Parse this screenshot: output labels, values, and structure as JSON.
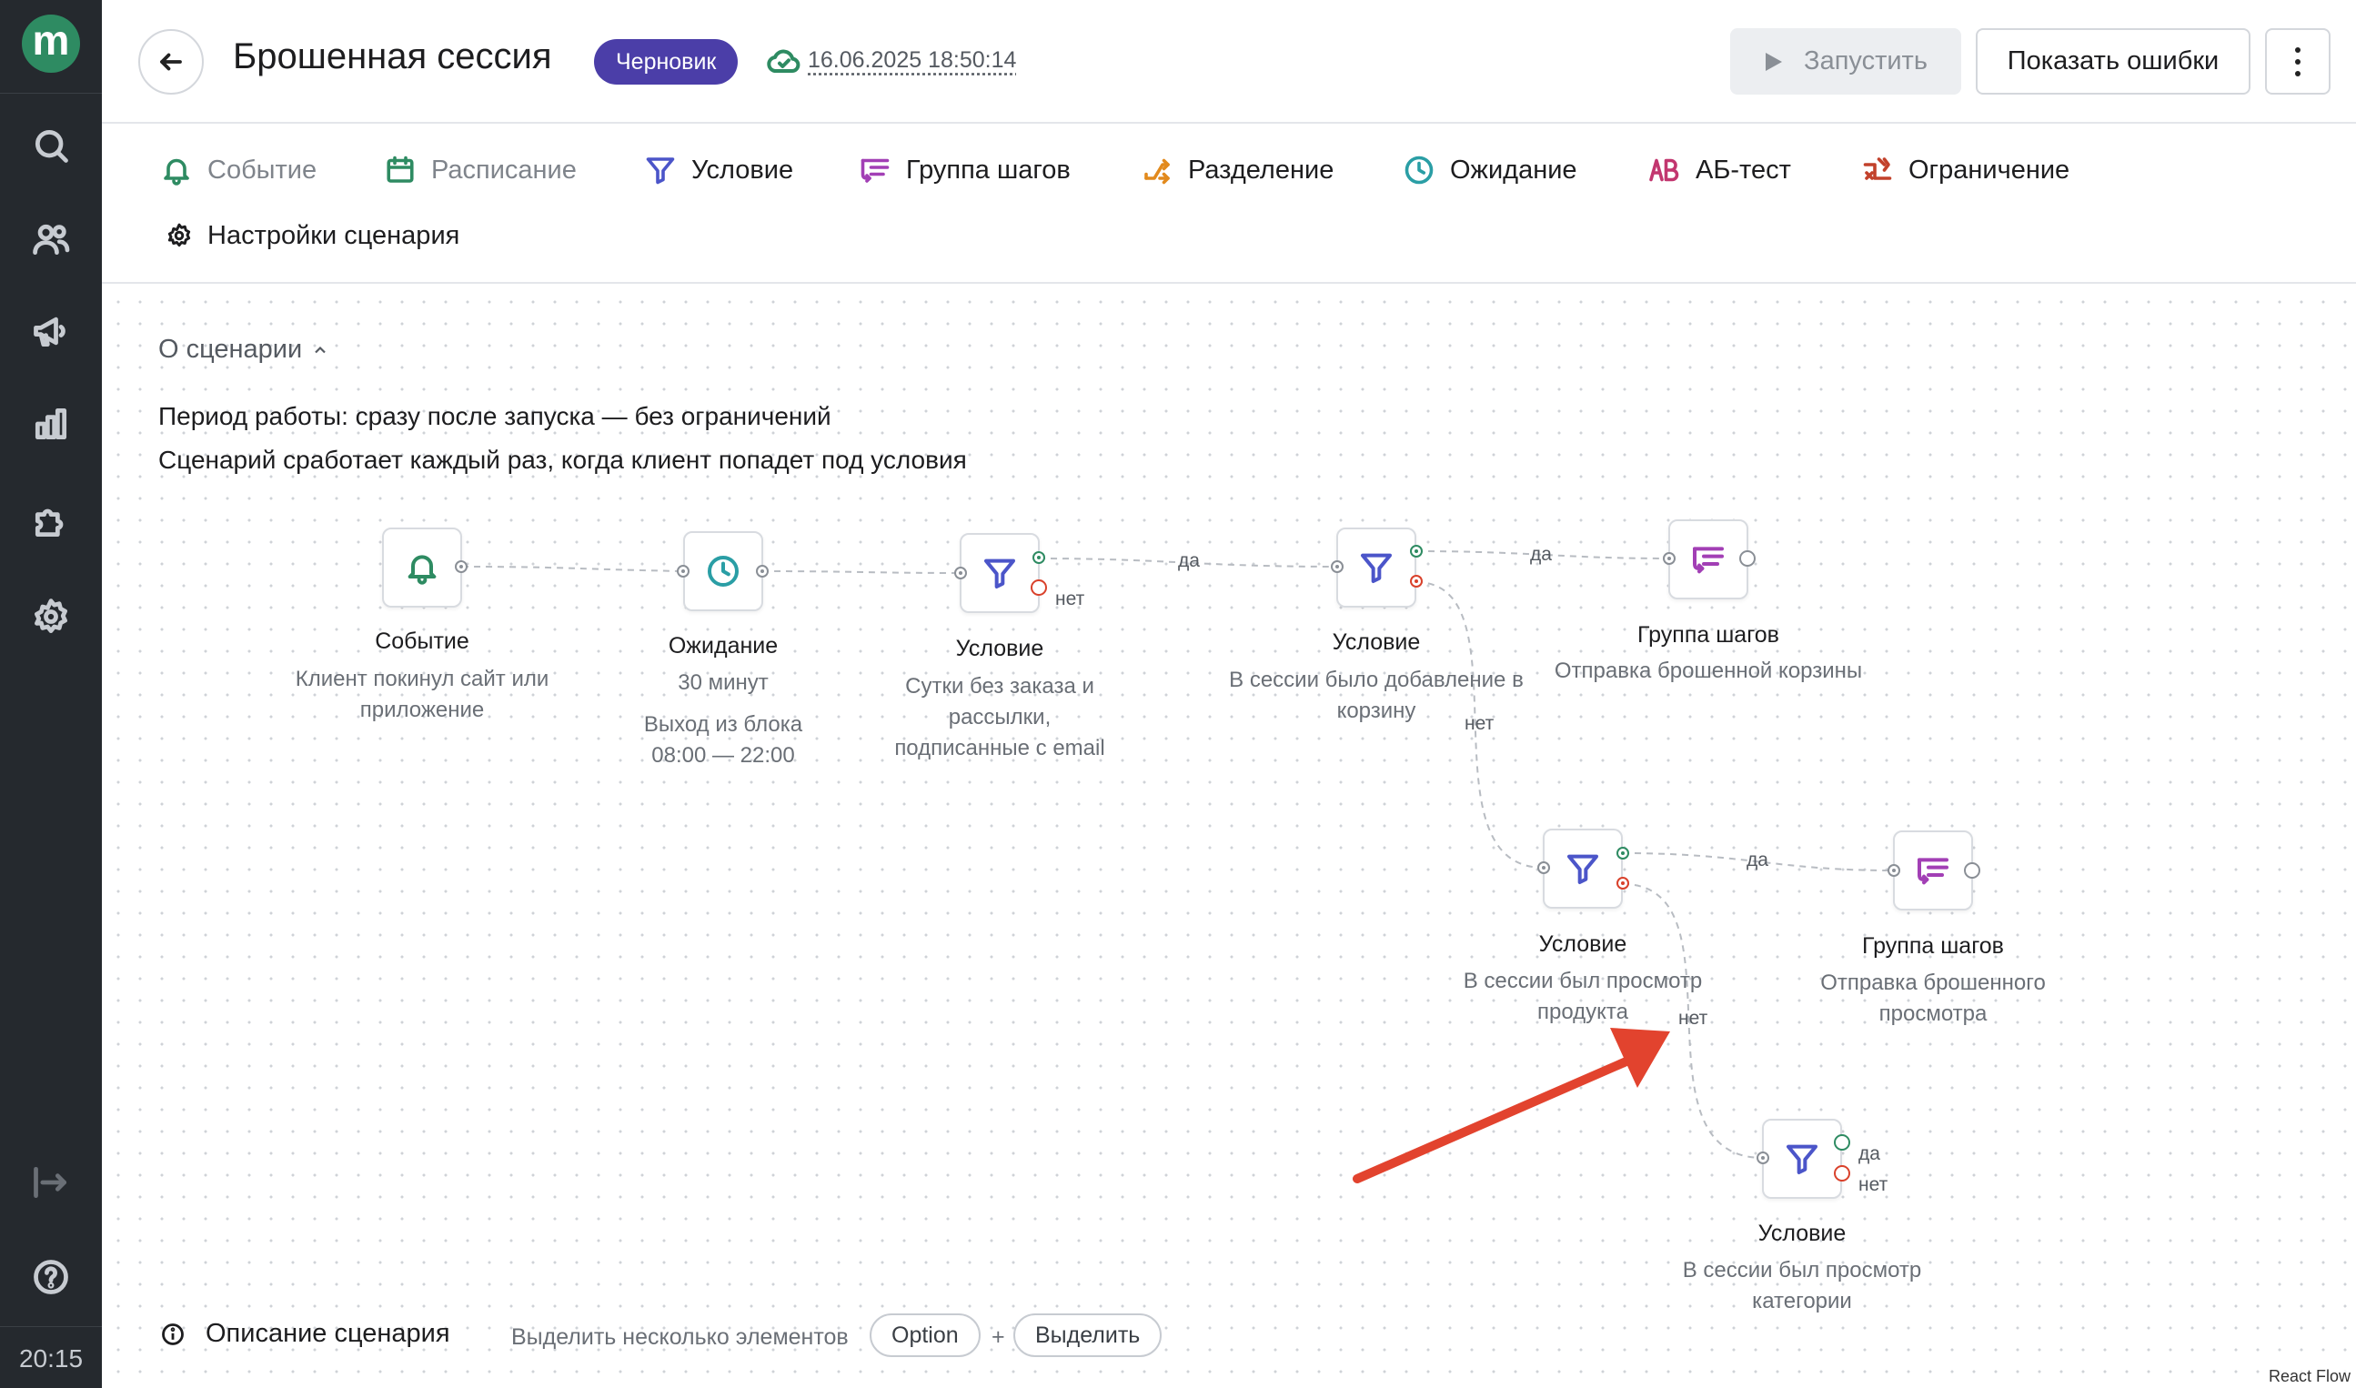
{
  "sidebar": {
    "logo": "m",
    "items": [
      {
        "name": "search-icon"
      },
      {
        "name": "users-icon"
      },
      {
        "name": "megaphone-icon"
      },
      {
        "name": "analytics-icon"
      },
      {
        "name": "puzzle-icon"
      },
      {
        "name": "gear-icon"
      }
    ],
    "collapse_icon": "collapse-icon",
    "help_icon": "help-icon",
    "time": "20:15"
  },
  "header": {
    "title": "Брошенная сессия",
    "status": "Черновик",
    "saved_at": "16.06.2025 18:50:14",
    "run_label": "Запустить",
    "errors_label": "Показать ошибки"
  },
  "toolbar": {
    "items": [
      {
        "label": "Событие",
        "icon": "bell-icon",
        "color": "#2e8b62",
        "disabled": true
      },
      {
        "label": "Расписание",
        "icon": "calendar-icon",
        "color": "#2e8b62",
        "disabled": true
      },
      {
        "label": "Условие",
        "icon": "filter-icon",
        "color": "#4b55c9",
        "disabled": false
      },
      {
        "label": "Группа шагов",
        "icon": "step-group-icon",
        "color": "#a23fb5",
        "disabled": false
      },
      {
        "label": "Разделение",
        "icon": "split-icon",
        "color": "#e28a1d",
        "disabled": false
      },
      {
        "label": "Ожидание",
        "icon": "clock-icon",
        "color": "#2a9ea5",
        "disabled": false
      },
      {
        "label": "АБ-тест",
        "icon": "ab-icon",
        "color": "#c2366f",
        "disabled": false
      },
      {
        "label": "Ограничение",
        "icon": "limit-icon",
        "color": "#c2412b",
        "disabled": false
      }
    ],
    "settings_label": "Настройки сценария"
  },
  "about": {
    "label": "О сценарии",
    "period": "Период работы: сразу после запуска — без ограничений",
    "trigger": "Сценарий сработает каждый раз, когда клиент попадет под условия"
  },
  "flow": {
    "nodes": [
      {
        "title": "Событие",
        "desc": "Клиент покинул сайт или приложение"
      },
      {
        "title": "Ожидание",
        "desc": "30 минут",
        "extra": "Выход из блока 08:00 — 22:00"
      },
      {
        "title": "Условие",
        "desc": "Сутки без заказа и рассылки, подписанные с email"
      },
      {
        "title": "Условие",
        "desc": "В сессии было добавление в корзину"
      },
      {
        "title": "Группа шагов",
        "desc": "Отправка брошенной корзины"
      },
      {
        "title": "Условие",
        "desc": "В сессии был просмотр продукта"
      },
      {
        "title": "Группа шагов",
        "desc": "Отправка брошенного просмотра"
      },
      {
        "title": "Условие",
        "desc": "В сессии был просмотр категории"
      }
    ],
    "edge_labels": {
      "yes": "да",
      "no": "нет"
    }
  },
  "bottom": {
    "description_label": "Описание сценария",
    "hint": "Выделить несколько элементов",
    "key1": "Option",
    "plus": "+",
    "key2": "Выделить"
  },
  "react_flow": "React Flow"
}
